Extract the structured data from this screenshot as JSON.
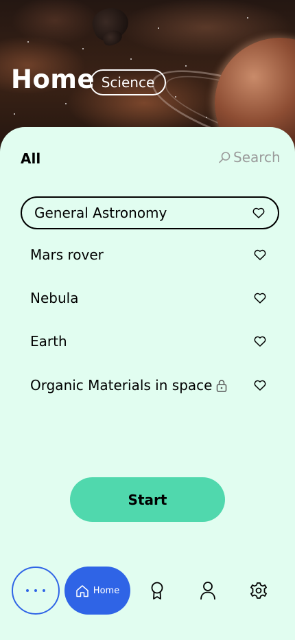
{
  "header": {
    "title": "Home",
    "category": "Science"
  },
  "filters": {
    "all_label": "All",
    "search_label": "Search"
  },
  "topics": [
    {
      "label": "General Astronomy",
      "selected": true,
      "locked": false
    },
    {
      "label": "Mars rover",
      "selected": false,
      "locked": false
    },
    {
      "label": "Nebula",
      "selected": false,
      "locked": false
    },
    {
      "label": "Earth",
      "selected": false,
      "locked": false
    },
    {
      "label": "Organic Materials in space",
      "selected": false,
      "locked": true
    }
  ],
  "start_label": "Start",
  "nav": {
    "home_label": "Home",
    "items": [
      "more-icon",
      "home-icon",
      "award-icon",
      "profile-icon",
      "settings-icon"
    ]
  },
  "colors": {
    "sheet": "#e1fdf0",
    "accent_blue": "#2f64e6",
    "start_green": "#50d8ad"
  }
}
